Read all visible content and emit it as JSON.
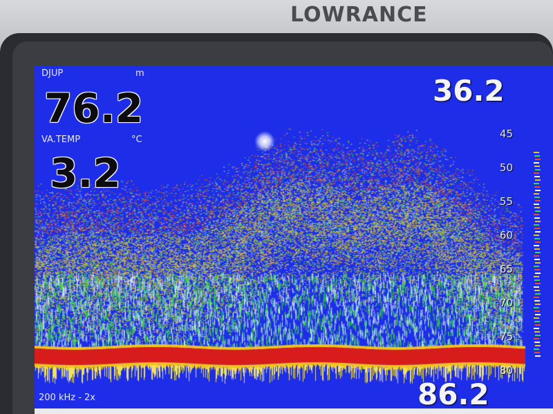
{
  "device": {
    "brand": "LOWRANCE"
  },
  "readouts": {
    "depth_label": "DJUP",
    "depth_unit": "m",
    "depth_value": "76.2",
    "temp_label": "VA.TEMP",
    "temp_unit": "°C",
    "temp_value": "3.2",
    "range_top": "36.2",
    "range_bottom": "86.2",
    "frequency": "200 kHz - 2x"
  },
  "depth_scale": {
    "ticks": [
      "45",
      "50",
      "55",
      "60",
      "65",
      "70",
      "75",
      "80"
    ]
  },
  "colors": {
    "water": "#1e2ee8",
    "bottom": "#d81c1c",
    "return_strong": "#e8501c",
    "return_medium": "#f2c21e",
    "return_weak": "#39d84a"
  }
}
